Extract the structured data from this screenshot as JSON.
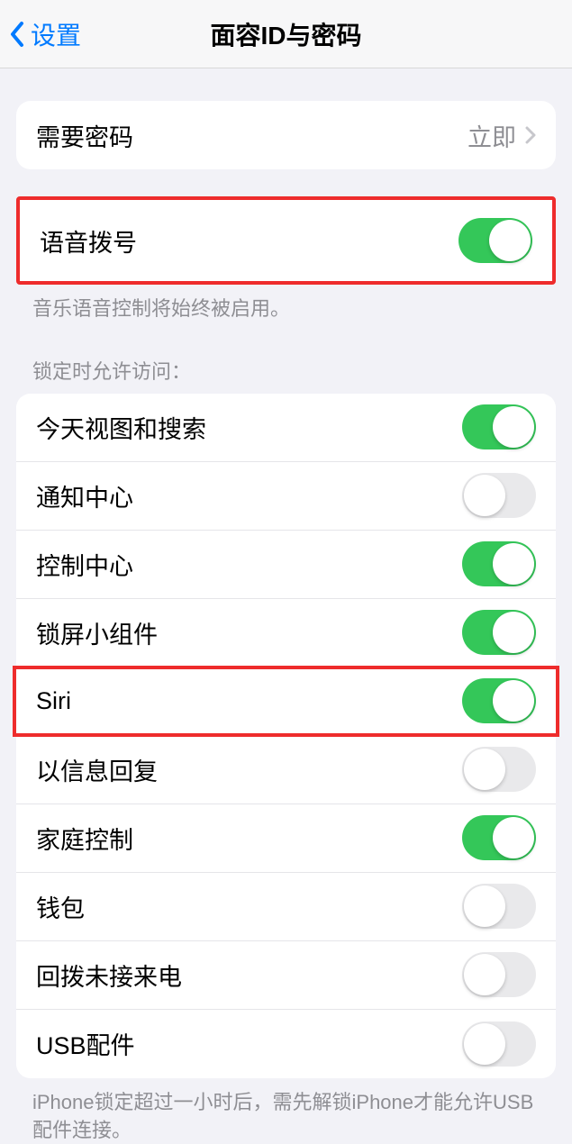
{
  "header": {
    "back_label": "设置",
    "title": "面容ID与密码"
  },
  "require_passcode": {
    "label": "需要密码",
    "value": "立即"
  },
  "voice_dial": {
    "label": "语音拨号",
    "enabled": true,
    "footer": "音乐语音控制将始终被启用。"
  },
  "lock_screen_section": {
    "header": "锁定时允许访问：",
    "items": [
      {
        "label": "今天视图和搜索",
        "enabled": true
      },
      {
        "label": "通知中心",
        "enabled": false
      },
      {
        "label": "控制中心",
        "enabled": true
      },
      {
        "label": "锁屏小组件",
        "enabled": true
      },
      {
        "label": "Siri",
        "enabled": true
      },
      {
        "label": "以信息回复",
        "enabled": false
      },
      {
        "label": "家庭控制",
        "enabled": true
      },
      {
        "label": "钱包",
        "enabled": false
      },
      {
        "label": "回拨未接来电",
        "enabled": false
      },
      {
        "label": "USB配件",
        "enabled": false
      }
    ],
    "footer": "iPhone锁定超过一小时后，需先解锁iPhone才能允许USB配件连接。"
  }
}
